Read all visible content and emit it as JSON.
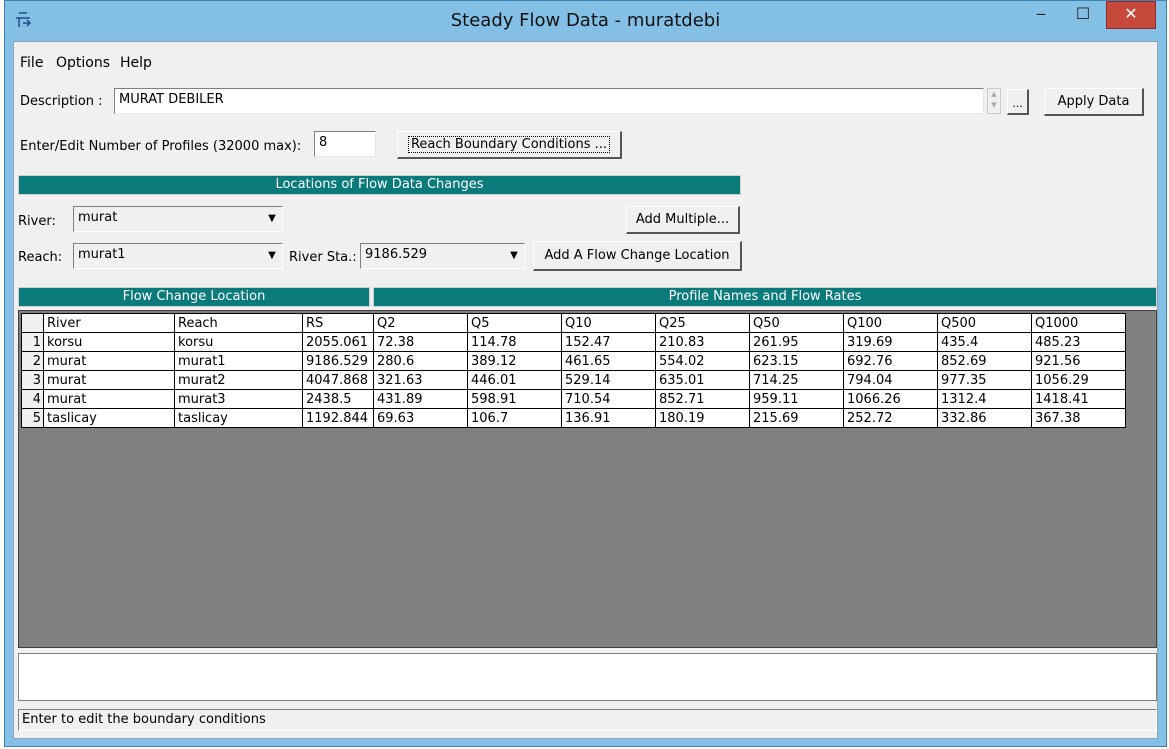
{
  "window": {
    "title": "Steady Flow Data - muratdebi",
    "minimize": "‒",
    "maximize": "☐",
    "close": "✕"
  },
  "menu": [
    "File",
    "Options",
    "Help"
  ],
  "description": {
    "label": "Description :",
    "value": "MURAT DEBILER",
    "ellipsis": "...",
    "apply_label": "Apply Data"
  },
  "profiles": {
    "label": "Enter/Edit Number of Profiles (32000 max):",
    "value": "8",
    "boundary_button": "Reach Boundary Conditions ..."
  },
  "locations": {
    "header": "Locations of Flow Data Changes",
    "river_label": "River:",
    "river_value": "murat",
    "reach_label": "Reach:",
    "reach_value": "murat1",
    "station_label": "River Sta.:",
    "station_value": "9186.529",
    "add_multiple": "Add Multiple...",
    "add_location": "Add A Flow Change Location"
  },
  "grid": {
    "left_header": "Flow Change Location",
    "right_header": "Profile Names and Flow Rates",
    "columns": [
      "River",
      "Reach",
      "RS",
      "Q2",
      "Q5",
      "Q10",
      "Q25",
      "Q50",
      "Q100",
      "Q500",
      "Q1000"
    ],
    "rows": [
      {
        "n": "1",
        "cells": [
          "korsu",
          "korsu",
          "2055.061",
          "72.38",
          "114.78",
          "152.47",
          "210.83",
          "261.95",
          "319.69",
          "435.4",
          "485.23"
        ]
      },
      {
        "n": "2",
        "cells": [
          "murat",
          "murat1",
          "9186.529",
          "280.6",
          "389.12",
          "461.65",
          "554.02",
          "623.15",
          "692.76",
          "852.69",
          "921.56"
        ]
      },
      {
        "n": "3",
        "cells": [
          "murat",
          "murat2",
          "4047.868",
          "321.63",
          "446.01",
          "529.14",
          "635.01",
          "714.25",
          "794.04",
          "977.35",
          "1056.29"
        ]
      },
      {
        "n": "4",
        "cells": [
          "murat",
          "murat3",
          "2438.5",
          "431.89",
          "598.91",
          "710.54",
          "852.71",
          "959.11",
          "1066.26",
          "1312.4",
          "1418.41"
        ]
      },
      {
        "n": "5",
        "cells": [
          "taslicay",
          "taslicay",
          "1192.844",
          "69.63",
          "106.7",
          "136.91",
          "180.19",
          "215.69",
          "252.72",
          "332.86",
          "367.38"
        ]
      }
    ]
  },
  "status": "Enter to edit the boundary conditions",
  "colors": {
    "section_header": "#0a7a7a",
    "titlebar": "#84c0e6",
    "close_button": "#c7493b",
    "grid_background": "#808080"
  }
}
